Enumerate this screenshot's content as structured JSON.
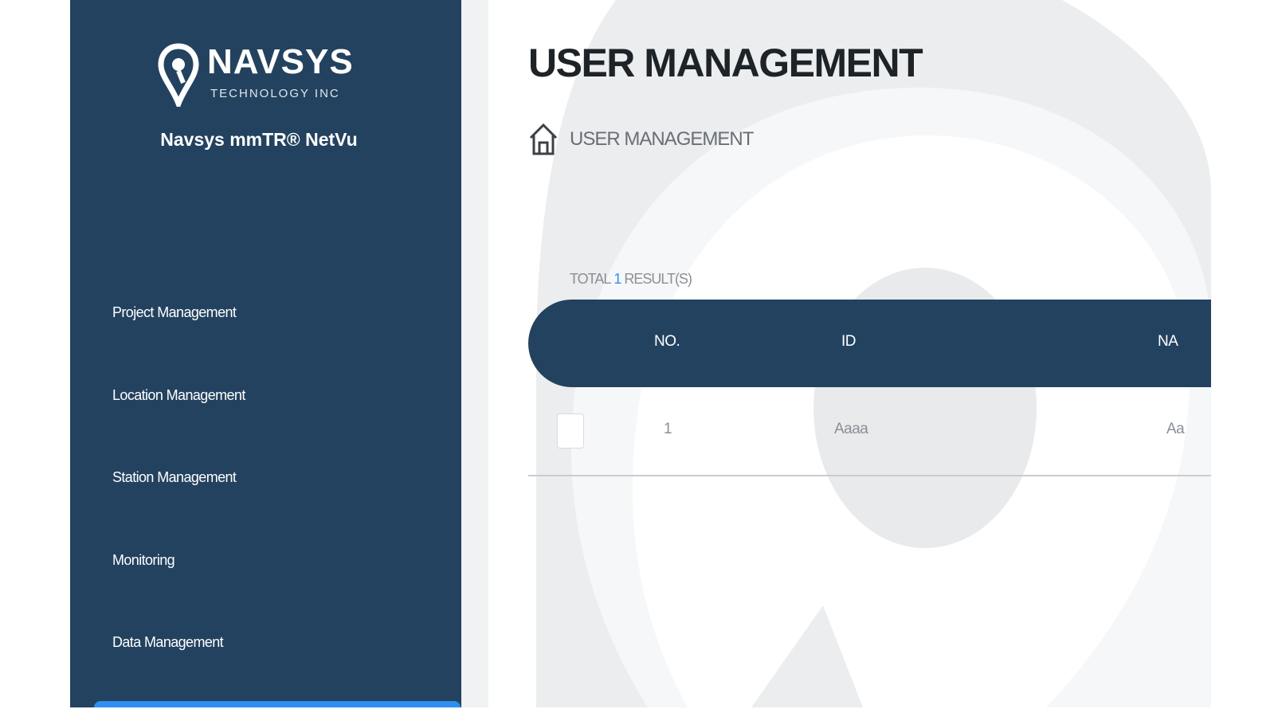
{
  "brand": {
    "logo_word": "NAVSYS",
    "logo_subtitle": "TECHNOLOGY INC",
    "product_name": "Navsys mmTR® NetVu"
  },
  "sidebar": {
    "items": [
      {
        "label": "Project Management"
      },
      {
        "label": "Location Management"
      },
      {
        "label": "Station Management"
      },
      {
        "label": "Monitoring"
      },
      {
        "label": "Data Management"
      }
    ]
  },
  "page": {
    "title": "USER MANAGEMENT",
    "breadcrumb": "USER MANAGEMENT"
  },
  "results": {
    "prefix": "TOTAL",
    "count": "1",
    "suffix": "RESULT(S)"
  },
  "table": {
    "columns": [
      "NO.",
      "ID",
      "NA"
    ],
    "rows": [
      {
        "no": "1",
        "id": "Aaaa",
        "name": "Aa"
      }
    ]
  },
  "colors": {
    "sidebar": "#23425f",
    "accent": "#2f8ff0",
    "title": "#1e2328"
  },
  "icons": {
    "logo": "map-pin-icon",
    "breadcrumb": "home-icon"
  }
}
